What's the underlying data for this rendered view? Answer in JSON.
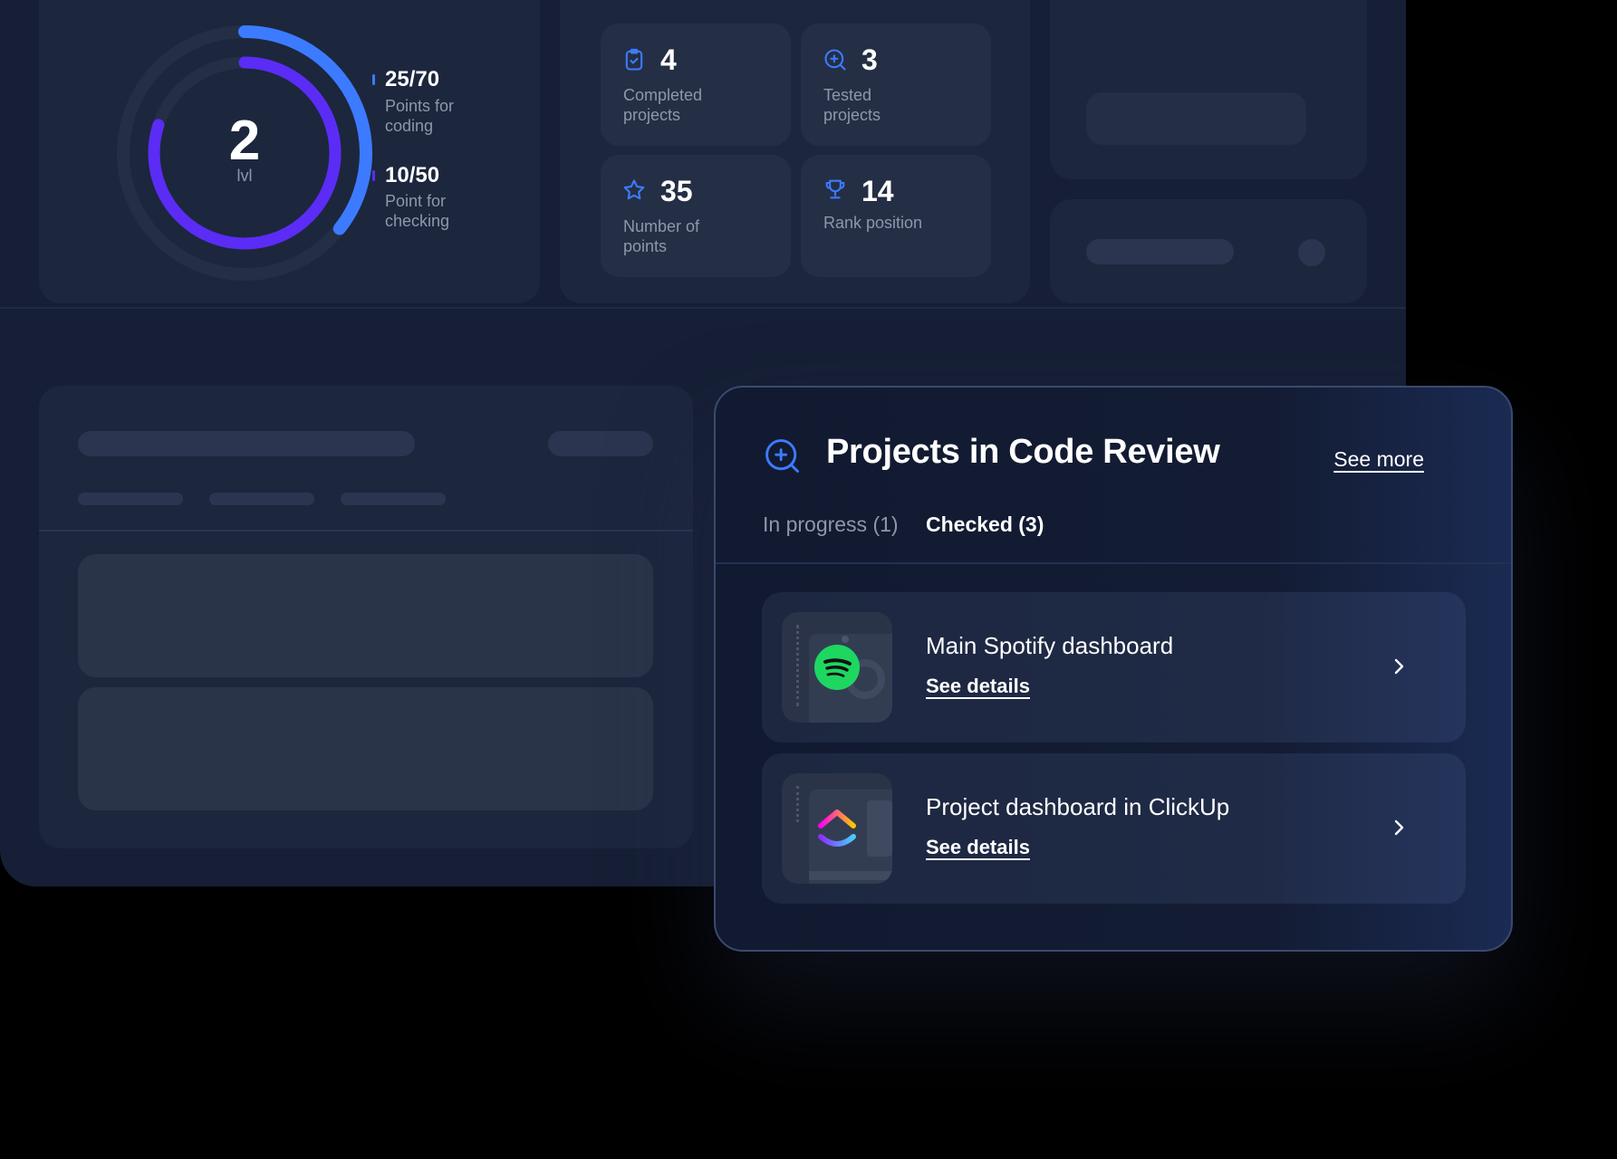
{
  "level": {
    "value": "2",
    "label": "lvl",
    "outer_progress": 0.357,
    "inner_progress": 0.8,
    "outer_color": "#3c7bff",
    "inner_color": "#5b2cf5"
  },
  "legend": [
    {
      "value": "25/70",
      "label": "Points for coding"
    },
    {
      "value": "10/50",
      "label": "Point for checking"
    }
  ],
  "stats": [
    {
      "icon": "clipboard-check-icon",
      "value": "4",
      "label": "Completed projects"
    },
    {
      "icon": "search-plus-icon",
      "value": "3",
      "label": "Tested projects"
    },
    {
      "icon": "star-icon",
      "value": "35",
      "label": "Number of points"
    },
    {
      "icon": "trophy-icon",
      "value": "14",
      "label": "Rank position"
    }
  ],
  "review": {
    "icon": "search-plus-icon",
    "title": "Projects in Code Review",
    "see_more": "See more",
    "tabs": [
      {
        "label": "In progress (1)",
        "active": false
      },
      {
        "label": "Checked (3)",
        "active": true
      }
    ],
    "projects": [
      {
        "name": "Main Spotify dashboard",
        "link": "See details",
        "logo": "spotify-logo-icon"
      },
      {
        "name": "Project dashboard in ClickUp",
        "link": "See details",
        "logo": "clickup-logo-icon"
      }
    ]
  },
  "colors": {
    "accent": "#3c7bff",
    "accent_purple": "#5b2cf5",
    "spotify_green": "#1ed760"
  }
}
